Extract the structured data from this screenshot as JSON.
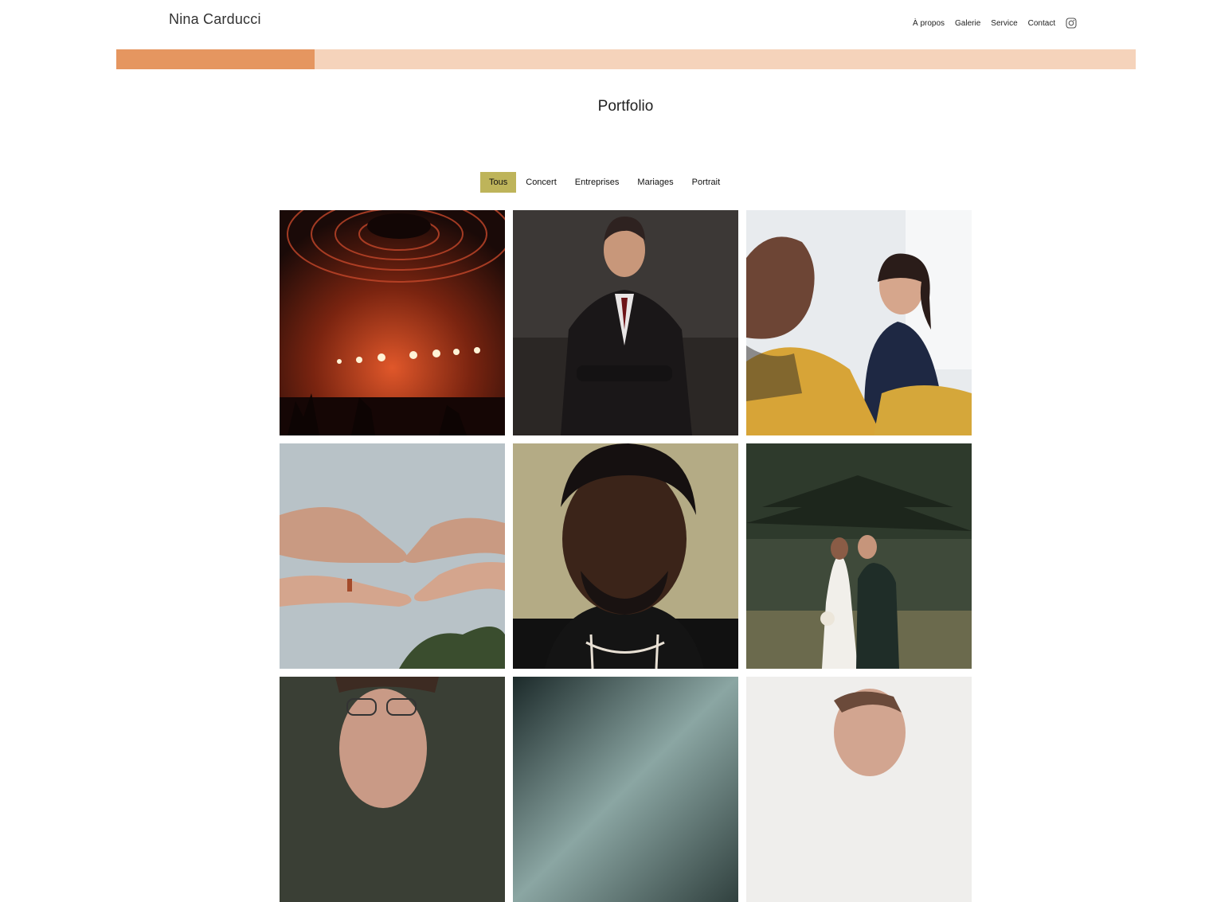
{
  "header": {
    "brand": "Nina Carducci",
    "nav": [
      {
        "label": "À propos"
      },
      {
        "label": "Galerie"
      },
      {
        "label": "Service"
      },
      {
        "label": "Contact"
      }
    ],
    "social_icon": "instagram-icon"
  },
  "progress": {
    "value": 0.1945,
    "fill_color": "#e59660",
    "track_color": "#f5d3bb"
  },
  "main": {
    "title": "Portfolio",
    "filters": [
      {
        "label": "Tous",
        "active": true
      },
      {
        "label": "Concert",
        "active": false
      },
      {
        "label": "Entreprises",
        "active": false
      },
      {
        "label": "Mariages",
        "active": false
      },
      {
        "label": "Portrait",
        "active": false
      }
    ],
    "active_filter_color": "#beb45a"
  },
  "gallery": {
    "tiles": [
      {
        "subject": "concert-stage-photo"
      },
      {
        "subject": "businessman-portrait-photo"
      },
      {
        "subject": "office-meeting-photo"
      },
      {
        "subject": "couple-hands-photo"
      },
      {
        "subject": "man-portrait-closeup-photo"
      },
      {
        "subject": "wedding-couple-photo"
      },
      {
        "subject": "woman-glasses-portrait-photo"
      },
      {
        "subject": "smoke-concert-photo"
      },
      {
        "subject": "bride-portrait-photo"
      }
    ]
  }
}
